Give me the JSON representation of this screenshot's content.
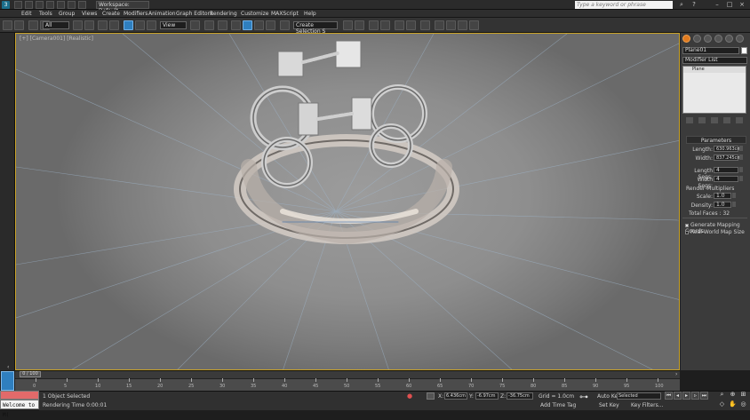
{
  "titlebar": {
    "workspace": "Workspace: Default",
    "search_placeholder": "Type a keyword or phrase"
  },
  "menu": [
    "Edit",
    "Tools",
    "Group",
    "Views",
    "Create",
    "Modifiers",
    "Animation",
    "Graph Editors",
    "Rendering",
    "Customize",
    "MAXScript",
    "Help"
  ],
  "toolbar": {
    "filter_value": "All",
    "refcoord_value": "View",
    "selection_set_placeholder": "Create Selection S"
  },
  "viewport": {
    "label": "[+] [Camera001] [Realistic]"
  },
  "command_panel": {
    "object_name": "Plane01",
    "modifier_list": "Modifier List",
    "stack_item": "Plane",
    "rollout_title": "Parameters",
    "length_label": "Length:",
    "length_value": "630.963cm",
    "width_label": "Width:",
    "width_value": "837.245cm",
    "length_segs_label": "Length Segs:",
    "length_segs_value": "4",
    "width_segs_label": "Width Segs:",
    "width_segs_value": "4",
    "render_multipliers_label": "Render Multipliers",
    "scale_label": "Scale:",
    "scale_value": "1.0",
    "density_label": "Density:",
    "density_value": "1.0",
    "total_faces": "Total Faces : 32",
    "gen_mapping": "Generate Mapping Coords.",
    "real_world": "Real-World Map Size"
  },
  "timeline": {
    "frame_indicator": "0 / 100",
    "ticks": [
      "0",
      "5",
      "10",
      "15",
      "20",
      "25",
      "30",
      "35",
      "40",
      "45",
      "50",
      "55",
      "60",
      "65",
      "70",
      "75",
      "80",
      "85",
      "90",
      "95",
      "100"
    ]
  },
  "status": {
    "selection_info": "1 Object Selected",
    "render_time": "Rendering Time  0:00:01",
    "x_label": "X:",
    "x_value": "6.436cm",
    "y_label": "Y:",
    "y_value": "-6.97cm",
    "z_label": "Z:",
    "z_value": "-36.75cm",
    "grid": "Grid = 1.0cm",
    "add_time_tag": "Add Time Tag",
    "auto_key": "Auto Key",
    "auto_key_value": "Selected",
    "set_key": "Set Key",
    "key_filters": "Key Filters...",
    "listener_text": "Welcome to M("
  },
  "colors": {
    "accent_blue": "#2f7fbf",
    "viewport_border": "#c9a227",
    "command_tab_active": "#e07a1f"
  }
}
